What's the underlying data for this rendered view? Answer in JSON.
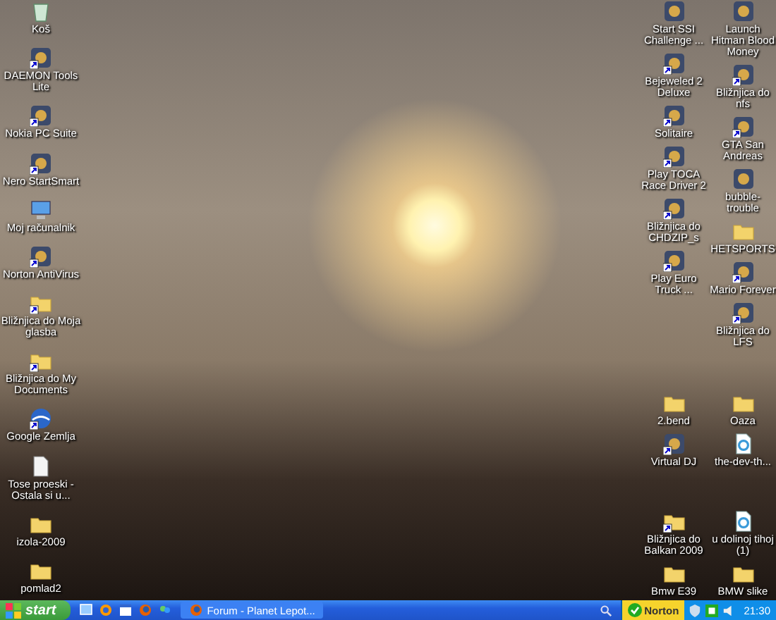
{
  "desktop": {
    "left_icons": [
      {
        "label": "Koš",
        "kind": "recycle",
        "shortcut": false
      },
      {
        "label": "DAEMON Tools Lite",
        "kind": "app",
        "shortcut": true
      },
      {
        "label": "Nokia PC Suite",
        "kind": "app",
        "shortcut": true
      },
      {
        "label": "Nero StartSmart",
        "kind": "app",
        "shortcut": true
      },
      {
        "label": "Moj računalnik",
        "kind": "computer",
        "shortcut": false
      },
      {
        "label": "Norton AntiVirus",
        "kind": "app",
        "shortcut": true
      },
      {
        "label": "Bližnjica do Moja glasba",
        "kind": "folder",
        "shortcut": true
      },
      {
        "label": "Bližnjica do My Documents",
        "kind": "folder",
        "shortcut": true
      },
      {
        "label": "Google Zemlja",
        "kind": "globe",
        "shortcut": true
      },
      {
        "label": "Tose proeski - Ostala si u...",
        "kind": "document",
        "shortcut": false
      },
      {
        "label": "izola-2009",
        "kind": "folder",
        "shortcut": false
      },
      {
        "label": "pomlad2",
        "kind": "folder",
        "shortcut": false
      }
    ],
    "right_groups": [
      {
        "columns": [
          [
            {
              "label": "Start SSI Challenge ...",
              "kind": "app",
              "shortcut": false
            },
            {
              "label": "Bejeweled 2 Deluxe",
              "kind": "app",
              "shortcut": true
            },
            {
              "label": "Solitaire",
              "kind": "app",
              "shortcut": true
            },
            {
              "label": "Play TOCA Race Driver 2",
              "kind": "app",
              "shortcut": true
            },
            {
              "label": "Bližnjica do CHDZIP_s",
              "kind": "app",
              "shortcut": true
            },
            {
              "label": "Play Euro Truck ...",
              "kind": "app",
              "shortcut": true
            }
          ],
          [
            {
              "label": "Launch Hitman Blood Money",
              "kind": "app",
              "shortcut": false
            },
            {
              "label": "Bližnjica do nfs",
              "kind": "app",
              "shortcut": true
            },
            {
              "label": "GTA San Andreas",
              "kind": "app",
              "shortcut": true
            },
            {
              "label": "bubble-trouble",
              "kind": "app",
              "shortcut": false
            },
            {
              "label": "HETSPORTS",
              "kind": "folder",
              "shortcut": false
            },
            {
              "label": "Mario Forever",
              "kind": "app",
              "shortcut": true
            },
            {
              "label": "Bližnjica do LFS",
              "kind": "app",
              "shortcut": true
            }
          ]
        ]
      },
      {
        "columns": [
          [
            {
              "label": "2.bend",
              "kind": "folder",
              "shortcut": false
            },
            {
              "label": "Virtual DJ",
              "kind": "app",
              "shortcut": true
            }
          ],
          [
            {
              "label": "Oaza",
              "kind": "folder",
              "shortcut": false
            },
            {
              "label": "the-dev-th...",
              "kind": "media",
              "shortcut": false
            }
          ]
        ]
      },
      {
        "columns": [
          [
            {
              "label": "Bližnjica do Balkan 2009",
              "kind": "folder",
              "shortcut": true
            },
            {
              "label": "Bmw E39",
              "kind": "folder",
              "shortcut": false
            }
          ],
          [
            {
              "label": "u dolinoj tihoj (1)",
              "kind": "media",
              "shortcut": false
            },
            {
              "label": "BMW slike",
              "kind": "folder",
              "shortcut": false
            }
          ]
        ]
      }
    ]
  },
  "taskbar": {
    "start": "start",
    "tasks": [
      {
        "label": "Forum - Planet Lepot...",
        "selected": false
      }
    ],
    "tray": {
      "badge": "Norton",
      "clock": "21:30"
    }
  }
}
